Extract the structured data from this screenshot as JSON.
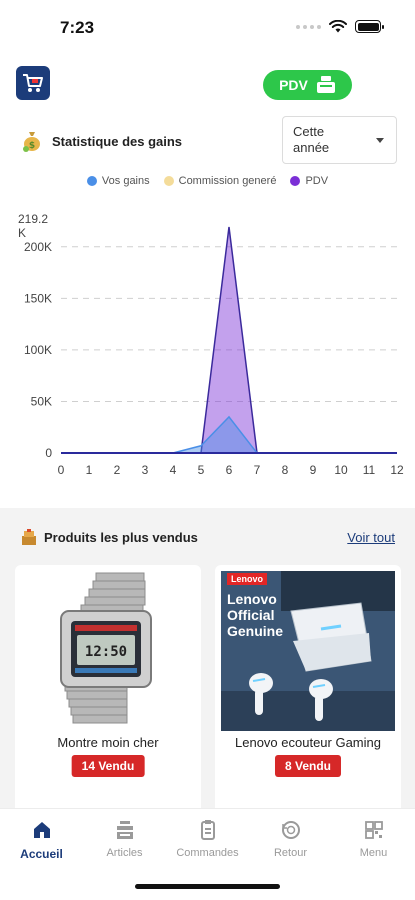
{
  "status": {
    "time": "7:23"
  },
  "header": {
    "pdv_label": "PDV"
  },
  "stats": {
    "title": "Statistique des gains",
    "period_select": "Cette année"
  },
  "legend": [
    {
      "label": "Vos gains",
      "color": "#4a8fe7"
    },
    {
      "label": "Commission generé",
      "color": "#f4dc9a"
    },
    {
      "label": "PDV",
      "color": "#7b2fd6"
    }
  ],
  "chart_data": {
    "type": "area",
    "x": [
      0,
      1,
      2,
      3,
      4,
      5,
      6,
      7,
      8,
      9,
      10,
      11,
      12
    ],
    "ylim": [
      0,
      219200
    ],
    "y_ticks": [
      "0",
      "50K",
      "100K",
      "150K",
      "200K",
      "219.2 K"
    ],
    "x_ticks": [
      "0",
      "1",
      "2",
      "3",
      "4",
      "5",
      "6",
      "7",
      "8",
      "9",
      "10",
      "11",
      "12"
    ],
    "grid": "horizontal dashed",
    "series": [
      {
        "name": "Vos gains",
        "color": "#4a8fe7",
        "values": [
          0,
          0,
          0,
          0,
          0,
          7000,
          35000,
          0,
          0,
          0,
          0,
          0,
          0
        ]
      },
      {
        "name": "Commission generé",
        "color": "#f4dc9a",
        "values": [
          0,
          0,
          0,
          0,
          0,
          0,
          0,
          0,
          0,
          0,
          0,
          0,
          0
        ]
      },
      {
        "name": "PDV",
        "color": "#7b2fd6",
        "values": [
          0,
          0,
          0,
          0,
          0,
          0,
          219200,
          0,
          0,
          0,
          0,
          0,
          0
        ]
      }
    ]
  },
  "products": {
    "title": "Produits les plus vendus",
    "see_all": "Voir tout",
    "items": [
      {
        "name": "Montre moin cher",
        "sold": "14 Vendu"
      },
      {
        "name": "Lenovo ecouteur Gaming",
        "sold": "8 Vendu",
        "image_text": [
          "Lenovo",
          "Lenovo",
          "Official",
          "Genuine"
        ]
      }
    ]
  },
  "tabs": [
    {
      "label": "Accueil",
      "active": true
    },
    {
      "label": "Articles",
      "active": false
    },
    {
      "label": "Commandes",
      "active": false
    },
    {
      "label": "Retour",
      "active": false
    },
    {
      "label": "Menu",
      "active": false
    }
  ],
  "colors": {
    "brand": "#1c3c7a",
    "pdv_button": "#2dc74a",
    "sold_badge": "#d62828"
  }
}
